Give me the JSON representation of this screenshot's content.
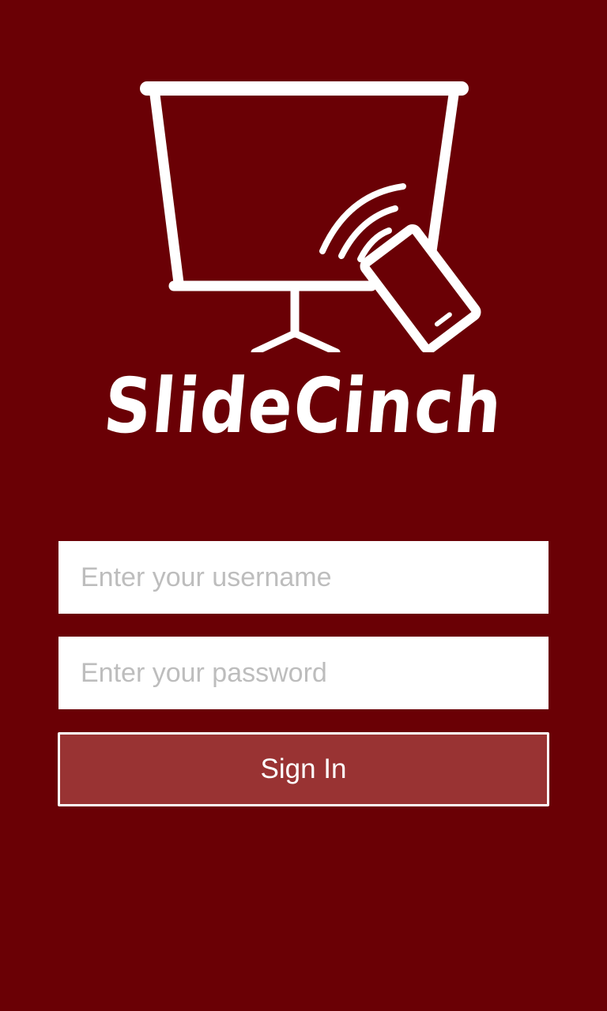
{
  "app": {
    "brand_name": "SlideCinch",
    "logo_icon": "projector-screen-with-wireless-phone-icon"
  },
  "login": {
    "username_placeholder": "Enter your username",
    "password_placeholder": "Enter your password",
    "username_value": "",
    "password_value": "",
    "sign_in_label": "Sign In"
  },
  "colors": {
    "background": "#6a0005",
    "button_fill": "#993333",
    "foreground": "#ffffff",
    "placeholder": "#bdbdbd"
  }
}
